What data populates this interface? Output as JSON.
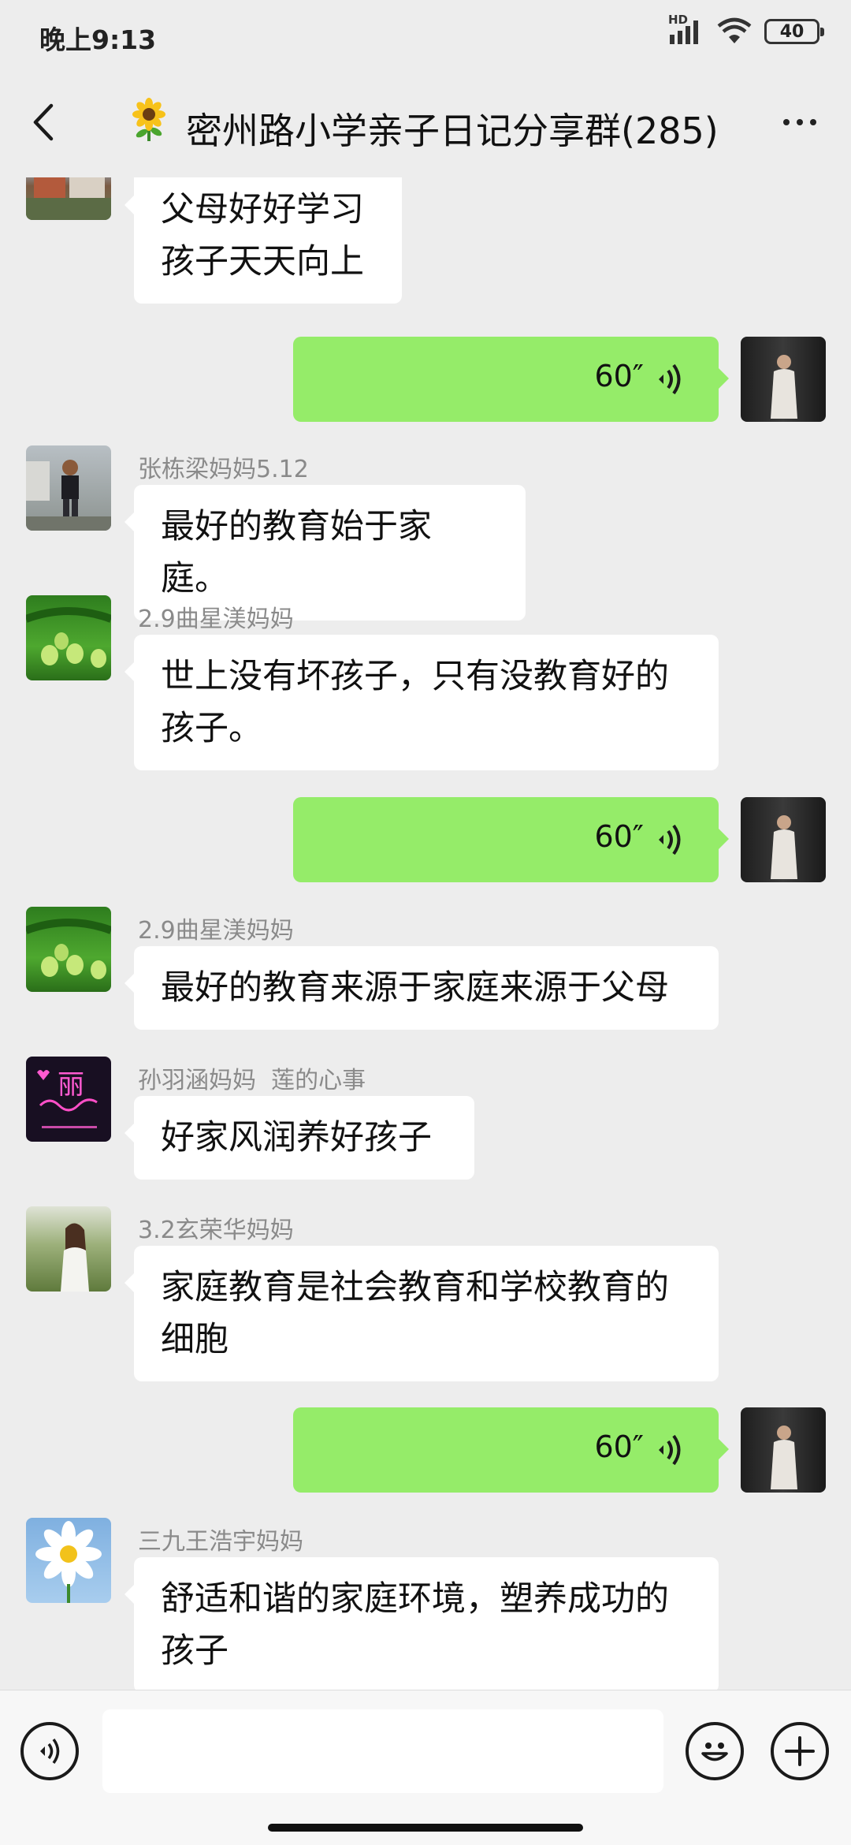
{
  "status_bar": {
    "time": "晚上9:13",
    "network_badge": "HD",
    "battery": "40"
  },
  "nav": {
    "title": "密州路小学亲子日记分享群(285)",
    "title_icon": "sunflower-icon"
  },
  "messages": [
    {
      "side": "left",
      "nickname": "",
      "text": "父母好好学习\n孩子天天向上",
      "avatar": "building-photo"
    },
    {
      "side": "right",
      "type": "voice",
      "duration": "60″",
      "avatar": "person-standing-photo"
    },
    {
      "side": "left",
      "nickname": "张栋梁妈妈5.12",
      "text": "最好的教育始于家庭。",
      "avatar": "child-photo"
    },
    {
      "side": "left",
      "nickname": "2.9曲星渼妈妈",
      "text": "世上没有坏孩子，只有没教育好的\n孩子。",
      "avatar": "green-berries-photo"
    },
    {
      "side": "right",
      "type": "voice",
      "duration": "60″",
      "avatar": "person-standing-photo"
    },
    {
      "side": "left",
      "nickname": "2.9曲星渼妈妈",
      "text": "最好的教育来源于家庭来源于父母",
      "avatar": "green-berries-photo"
    },
    {
      "side": "left",
      "nickname": "孙羽涵妈妈  莲的心事",
      "text": "好家风润养好孩子",
      "avatar": "neon-sign-photo",
      "avatar_text": "丽"
    },
    {
      "side": "left",
      "nickname": "3.2玄荣华妈妈",
      "text": "家庭教育是社会教育和学校教育的\n细胞",
      "avatar": "woman-outdoor-photo"
    },
    {
      "side": "right",
      "type": "voice",
      "duration": "60″",
      "avatar": "person-standing-photo"
    },
    {
      "side": "left",
      "nickname": "三九王浩宇妈妈",
      "text": "舒适和谐的家庭环境，塑养成功的\n孩子",
      "avatar": "daisy-photo"
    }
  ],
  "input_bar": {
    "placeholder": "",
    "voice_icon": "voice-mode-icon",
    "emoji_icon": "emoji-icon",
    "plus_icon": "plus-icon"
  },
  "colors": {
    "background": "#ededed",
    "voice_bubble": "#95ec69",
    "text_bubble": "#ffffff"
  }
}
